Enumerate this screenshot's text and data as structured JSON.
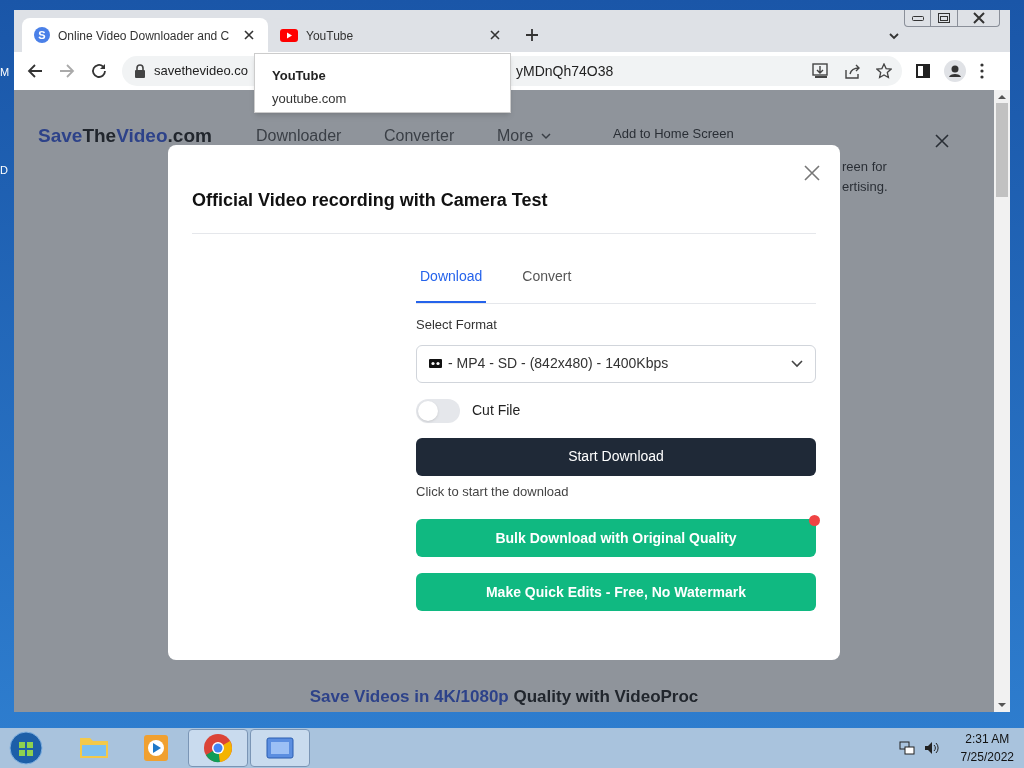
{
  "desktop": {
    "icon_labels": [
      "M",
      "D"
    ]
  },
  "browser": {
    "tabs": [
      {
        "title": "Online Video Downloader and C",
        "favicon_letter": "S",
        "selected": true
      },
      {
        "title": "YouTube",
        "selected": false
      }
    ],
    "tooltip": {
      "title": "YouTube",
      "url": "youtube.com"
    },
    "address": {
      "start": "savethevideo.co",
      "end": "yMDnQh74O38"
    }
  },
  "page": {
    "logo": [
      {
        "text": "Save",
        "accent": true
      },
      {
        "text": "The",
        "accent": false
      },
      {
        "text": "Video",
        "accent": true
      },
      {
        "text": ".com",
        "accent": false
      }
    ],
    "nav": [
      {
        "label": "Downloader",
        "dropdown": false
      },
      {
        "label": "Converter",
        "dropdown": false
      },
      {
        "label": "More",
        "dropdown": true
      }
    ],
    "banner": {
      "title": "Add to Home Screen",
      "lines": [
        "reen for",
        "ertising."
      ]
    },
    "promo": [
      {
        "text": "Save Videos in 4K/1080p",
        "accent": true
      },
      {
        "text": " Quality with VideoProc",
        "accent": false
      }
    ]
  },
  "modal": {
    "title": "Official Video recording with Camera Test",
    "tabs": [
      {
        "label": "Download",
        "selected": true
      },
      {
        "label": "Convert",
        "selected": false
      }
    ],
    "select_label": "Select Format",
    "select_value": "- MP4 - SD - (842x480) - 1400Kbps",
    "toggle": {
      "label": "Cut File",
      "on": false
    },
    "primary_button": "Start Download",
    "hint": "Click to start the download",
    "actions": [
      {
        "label": "Bulk Download with Original Quality",
        "dot": true
      },
      {
        "label": "Make Quick Edits - Free, No Watermark",
        "dot": false
      }
    ]
  },
  "taskbar": {
    "apps": [
      {
        "kind": "folder",
        "selected": false
      },
      {
        "kind": "media",
        "selected": false
      },
      {
        "kind": "chrome",
        "selected": true
      },
      {
        "kind": "gui",
        "selected": true
      }
    ],
    "time": "2:31 AM",
    "date": "7/25/2022"
  }
}
